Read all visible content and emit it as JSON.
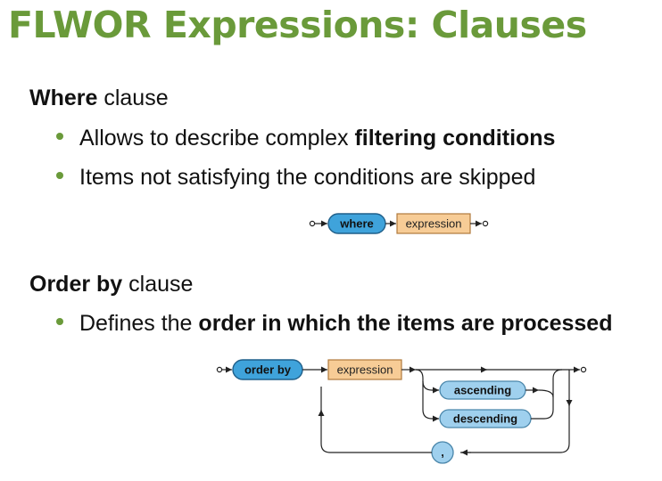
{
  "title": "FLWOR Expressions: Clauses",
  "where_section": {
    "heading_bold": "Where",
    "heading_rest": " clause",
    "bullets": [
      {
        "pre": "Allows to describe complex ",
        "bold": "filtering conditions",
        "post": ""
      },
      {
        "pre": "Items not satisfying the conditions are skipped",
        "bold": "",
        "post": ""
      }
    ],
    "diagram": {
      "keyword": "where",
      "expression": "expression"
    }
  },
  "orderby_section": {
    "heading_bold": "Order by",
    "heading_rest": " clause",
    "bullets": [
      {
        "pre": "Defines the ",
        "bold": "order in which the items are processed",
        "post": ""
      }
    ],
    "diagram": {
      "keyword": "order by",
      "expression": "expression",
      "ascending": "ascending",
      "descending": "descending",
      "separator": ","
    }
  },
  "colors": {
    "title_green": "#6a9a3a",
    "bullet_green": "#6a9a3a",
    "keyword_fill": "#3fa3db",
    "keyword_stroke": "#1f5f8a",
    "expression_fill": "#f7cc96",
    "expression_stroke": "#b07a3c",
    "option_fill": "#9fd0ee",
    "option_stroke": "#4a86aa"
  }
}
